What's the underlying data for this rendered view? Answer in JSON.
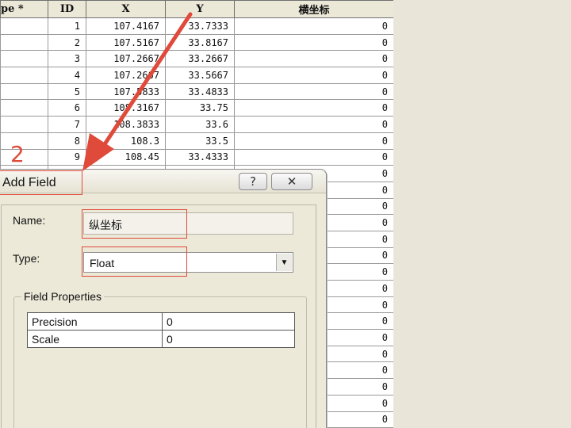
{
  "table": {
    "headers": [
      "pe *",
      "ID",
      "X",
      "Y",
      "横坐标"
    ],
    "rows": [
      {
        "id": "1",
        "x": "107.4167",
        "y": "33.7333",
        "h": "0"
      },
      {
        "id": "2",
        "x": "107.5167",
        "y": "33.8167",
        "h": "0"
      },
      {
        "id": "3",
        "x": "107.2667",
        "y": "33.2667",
        "h": "0"
      },
      {
        "id": "4",
        "x": "107.2667",
        "y": "33.5667",
        "h": "0"
      },
      {
        "id": "5",
        "x": "107.5833",
        "y": "33.4833",
        "h": "0"
      },
      {
        "id": "6",
        "x": "108.3167",
        "y": "33.75",
        "h": "0"
      },
      {
        "id": "7",
        "x": "108.3833",
        "y": "33.6",
        "h": "0"
      },
      {
        "id": "8",
        "x": "108.3",
        "y": "33.5",
        "h": "0"
      },
      {
        "id": "9",
        "x": "108.45",
        "y": "33.4333",
        "h": "0"
      },
      {
        "id": "",
        "x": "",
        "y": "",
        "h": "0"
      },
      {
        "id": "",
        "x": "",
        "y": "",
        "h": "0"
      },
      {
        "id": "",
        "x": "",
        "y": "",
        "h": "0"
      },
      {
        "id": "",
        "x": "",
        "y": "",
        "h": "0"
      },
      {
        "id": "",
        "x": "",
        "y": "",
        "h": "0"
      },
      {
        "id": "",
        "x": "",
        "y": "",
        "h": "0"
      },
      {
        "id": "",
        "x": "",
        "y": "",
        "h": "0"
      },
      {
        "id": "",
        "x": "",
        "y": "",
        "h": "0"
      },
      {
        "id": "",
        "x": "",
        "y": "",
        "h": "0"
      },
      {
        "id": "",
        "x": "",
        "y": "",
        "h": "0"
      },
      {
        "id": "",
        "x": "",
        "y": "",
        "h": "0"
      },
      {
        "id": "",
        "x": "",
        "y": "",
        "h": "0"
      },
      {
        "id": "",
        "x": "",
        "y": "",
        "h": "0"
      },
      {
        "id": "",
        "x": "",
        "y": "",
        "h": "0"
      },
      {
        "id": "",
        "x": "",
        "y": "",
        "h": "0"
      },
      {
        "id": "",
        "x": "",
        "y": "",
        "h": "0"
      },
      {
        "id": "",
        "x": "",
        "y": "",
        "h": "0"
      }
    ]
  },
  "dialog": {
    "title": "Add Field",
    "help_icon": "help-icon",
    "close_icon": "close-icon",
    "name_label": "Name:",
    "name_value": "纵坐标",
    "type_label": "Type:",
    "type_value": "Float",
    "field_properties_label": "Field Properties",
    "properties": [
      {
        "name": "Precision",
        "value": "0"
      },
      {
        "name": "Scale",
        "value": "0"
      }
    ]
  },
  "annotation": {
    "step_number": "2",
    "color": "#e04a3a"
  }
}
